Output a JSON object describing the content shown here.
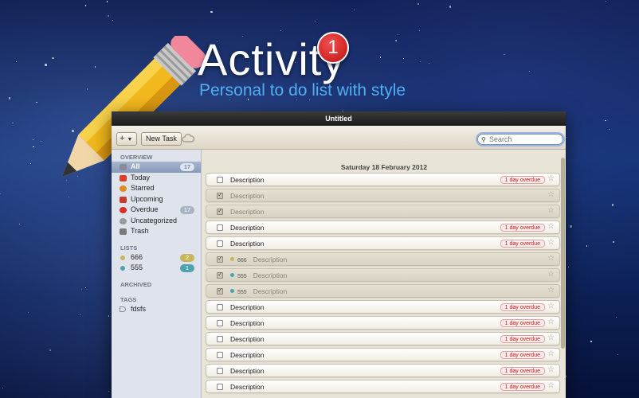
{
  "hero": {
    "title": "Activity",
    "badge": "1",
    "subtitle": "Personal to do list with style"
  },
  "window": {
    "title": "Untitled"
  },
  "toolbar": {
    "add_label": "+",
    "new_task_label": "New Task",
    "search_placeholder": "Search"
  },
  "sidebar": {
    "overview_heading": "OVERVIEW",
    "items": [
      {
        "label": "All",
        "count": "17",
        "icon": "all-icon",
        "color": "#8a8a9a",
        "active": true
      },
      {
        "label": "Today",
        "count": "",
        "icon": "calendar-icon",
        "color": "#d8402a"
      },
      {
        "label": "Starred",
        "count": "",
        "icon": "starred-icon",
        "color": "#e08a1a"
      },
      {
        "label": "Upcoming",
        "count": "",
        "icon": "upcoming-icon",
        "color": "#c83a2a"
      },
      {
        "label": "Overdue",
        "count": "17",
        "icon": "overdue-icon",
        "color": "#e02b2b"
      },
      {
        "label": "Uncategorized",
        "count": "",
        "icon": "uncategorized-icon",
        "color": "#9a9a9a"
      },
      {
        "label": "Trash",
        "count": "",
        "icon": "trash-icon",
        "color": "#7a7a7a"
      }
    ],
    "lists_heading": "LISTS",
    "lists": [
      {
        "label": "666",
        "count": "2",
        "color": "#c9b65a"
      },
      {
        "label": "555",
        "count": "1",
        "color": "#4fa3b0"
      }
    ],
    "archived_heading": "ARCHIVED",
    "tags_heading": "TAGS",
    "tags": [
      {
        "label": "fdsfs",
        "icon": "tag-icon"
      }
    ]
  },
  "main": {
    "date_heading": "Saturday 18 February 2012",
    "tasks": [
      {
        "text": "Description",
        "done": false,
        "overdue": "1 day overdue"
      },
      {
        "text": "Description",
        "done": true,
        "overdue": ""
      },
      {
        "text": "Description",
        "done": true,
        "overdue": ""
      },
      {
        "text": "Description",
        "done": false,
        "overdue": "1 day overdue"
      },
      {
        "text": "Description",
        "done": false,
        "overdue": "1 day overdue"
      },
      {
        "text": "Description",
        "done": true,
        "overdue": "",
        "list": "666",
        "list_color": "#c9b65a"
      },
      {
        "text": "Description",
        "done": true,
        "overdue": "",
        "list": "555",
        "list_color": "#4fa3b0"
      },
      {
        "text": "Description",
        "done": true,
        "overdue": "",
        "list": "555",
        "list_color": "#4fa3b0"
      },
      {
        "text": "Description",
        "done": false,
        "overdue": "1 day overdue"
      },
      {
        "text": "Description",
        "done": false,
        "overdue": "1 day overdue"
      },
      {
        "text": "Description",
        "done": false,
        "overdue": "1 day overdue"
      },
      {
        "text": "Description",
        "done": false,
        "overdue": "1 day overdue"
      },
      {
        "text": "Description",
        "done": false,
        "overdue": "1 day overdue"
      },
      {
        "text": "Description",
        "done": false,
        "overdue": "1 day overdue"
      }
    ]
  }
}
